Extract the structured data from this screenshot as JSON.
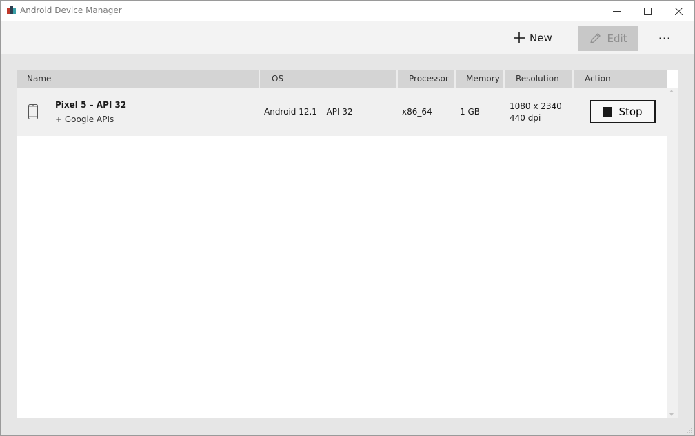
{
  "window": {
    "title": "Android Device Manager",
    "app_icon": "android-device-manager-icon",
    "controls": [
      "minimize-icon",
      "maximize-icon",
      "close-icon"
    ]
  },
  "toolbar": {
    "new_label": "New",
    "new_icon": "plus-icon",
    "edit_label": "Edit",
    "edit_icon": "pencil-icon",
    "edit_enabled": false,
    "more_label": "···"
  },
  "table": {
    "columns": [
      "Name",
      "OS",
      "Processor",
      "Memory",
      "Resolution",
      "Action"
    ],
    "rows": [
      {
        "icon": "phone-icon",
        "name": "Pixel 5 – API 32",
        "subtitle": "+ Google APIs",
        "os": "Android 12.1 – API 32",
        "processor": "x86_64",
        "memory": "1 GB",
        "resolution": "1080 x 2340",
        "density": "440 dpi",
        "action_label": "Stop",
        "action_icon": "stop-icon"
      }
    ]
  },
  "colors": {
    "accent": "#1a1a1a",
    "header_bg": "#d4d4d4",
    "row_bg": "#f0f0f0",
    "edit_disabled_bg": "#c8c8c8"
  }
}
